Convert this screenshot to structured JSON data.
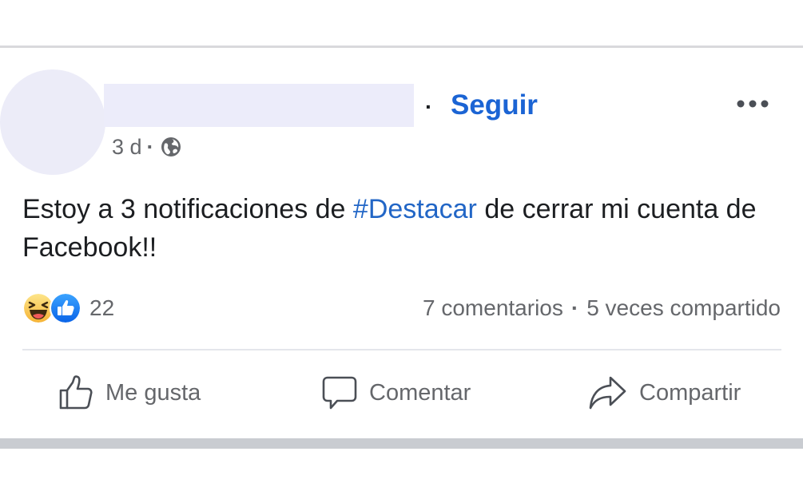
{
  "post": {
    "follow_label": "Seguir",
    "separator": "·",
    "timestamp": "3 d",
    "meta_separator": "·",
    "privacy_icon": "globe-icon",
    "text_before": "Estoy a 3 notificaciones de ",
    "hashtag": "#Destacar",
    "text_after": " de cerrar mi cuenta de Facebook!!"
  },
  "reactions": {
    "icons": [
      "haha-reaction-icon",
      "like-reaction-icon"
    ],
    "count": "22"
  },
  "stats": {
    "comments": "7 comentarios",
    "separator": "·",
    "shares": "5 veces compartido"
  },
  "actions": {
    "like_label": "Me gusta",
    "comment_label": "Comentar",
    "share_label": "Compartir"
  },
  "colors": {
    "link_blue": "#1b64d4",
    "hashtag_blue": "#2266c6",
    "secondary_text": "#65676b",
    "primary_text": "#1c1e21",
    "redacted_placeholder": "#ececfa"
  }
}
